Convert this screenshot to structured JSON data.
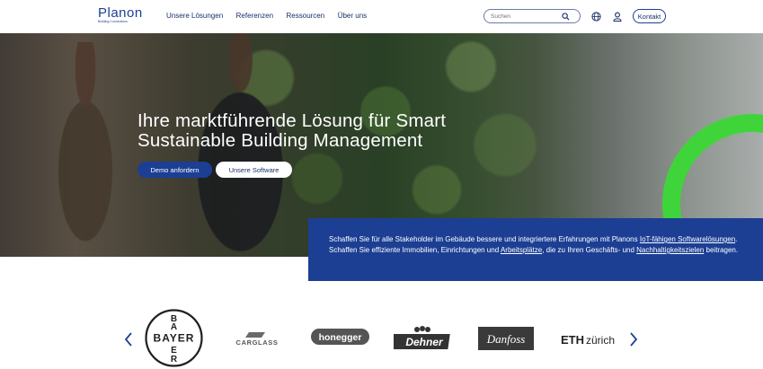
{
  "header": {
    "logo_text": "Planon",
    "logo_subtext": "Building Connections",
    "nav": [
      {
        "label": "Unsere Lösungen"
      },
      {
        "label": "Referenzen"
      },
      {
        "label": "Ressourcen"
      },
      {
        "label": "Über uns"
      }
    ],
    "search_placeholder": "Suchen",
    "contact_label": "Kontakt"
  },
  "hero": {
    "title": "Ihre marktführende Lösung für Smart Sustainable Building Management",
    "demo_label": "Demo anfordern",
    "software_label": "Unsere Software"
  },
  "info": {
    "text_1": "Schaffen Sie für alle Stakeholder im Gebäude bessere und integriertere Erfahrungen mit Planons ",
    "link_1": "IoT-fähigen Softwarelösungen",
    "text_2": ". Schaffen Sie effiziente Immobilien, Einrichtungen und ",
    "link_2": "Arbeitsplätze",
    "text_3": ", die zu Ihren Geschäfts- und ",
    "link_3": "Nachhaltigkeitszielen",
    "text_4": " beitragen."
  },
  "clients": {
    "bayer": "BAYER",
    "carglass": "CARGLASS",
    "honegger": "honegger",
    "dehner": "Dehner",
    "danfoss": "Danfoss",
    "eth_bold": "ETH",
    "eth_light": "zürich"
  },
  "colors": {
    "brand_blue": "#1c3f94",
    "accent_green": "#3fd53a"
  }
}
